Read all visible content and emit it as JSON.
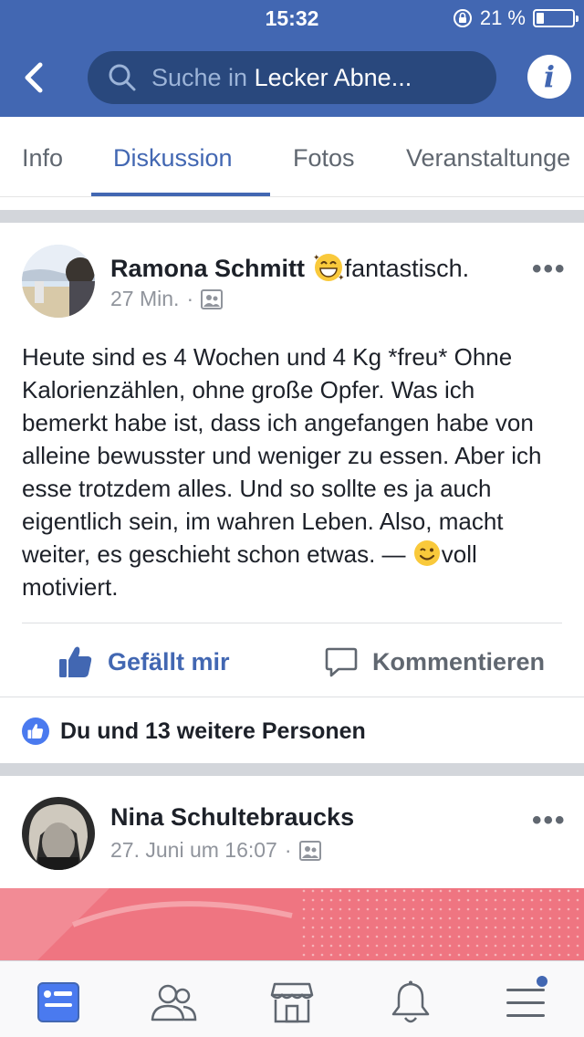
{
  "status_bar": {
    "time": "15:32",
    "battery_percent": "21 %",
    "battery_level": 0.21,
    "icons": [
      "orientation-lock-icon",
      "battery-icon"
    ]
  },
  "nav": {
    "back_icon": "chevron-left-icon",
    "search_prefix": "Suche in",
    "search_group": "Lecker Abne...",
    "info_label": "i"
  },
  "tabs": [
    {
      "label": "Info",
      "active": false
    },
    {
      "label": "Diskussion",
      "active": true
    },
    {
      "label": "Fotos",
      "active": false
    },
    {
      "label": "Veranstaltunge",
      "active": false
    }
  ],
  "posts": [
    {
      "author": "Ramona Schmitt",
      "feeling_text": "fantastisch.",
      "feeling_icon": "grinning-face-icon",
      "time": "27 Min.",
      "audience_icon": "group-audience-icon",
      "more": "•••",
      "body": "Heute sind es 4 Wochen und 4 Kg *freu* Ohne Kalorienzählen, ohne große Opfer. Was ich bemerkt habe ist, dass ich angefangen habe von alleine bewusster und weniger zu essen. Aber ich esse trotzdem alles. Und so sollte es ja auch eigentlich sein, im wahren Leben. Also, macht weiter, es geschieht schon etwas. —",
      "feeling_suffix": "voll motiviert.",
      "actions": {
        "like": "Gefällt mir",
        "comment": "Kommentieren"
      },
      "reactions_text": "Du und 13 weitere Personen"
    },
    {
      "author": "Nina Schultebraucks",
      "time": "27. Juni um 16:07",
      "audience_icon": "group-audience-icon",
      "more": "•••"
    }
  ],
  "bottom_nav": [
    {
      "icon": "news-feed-icon",
      "active": true
    },
    {
      "icon": "friends-icon",
      "active": false
    },
    {
      "icon": "marketplace-icon",
      "active": false
    },
    {
      "icon": "notifications-bell-icon",
      "active": false
    },
    {
      "icon": "menu-icon",
      "active": false,
      "badge": true
    }
  ],
  "colors": {
    "brand_blue": "#4267b2",
    "search_bg": "#29487d",
    "text_secondary": "#90949c",
    "banner_pink": "#f07480"
  }
}
